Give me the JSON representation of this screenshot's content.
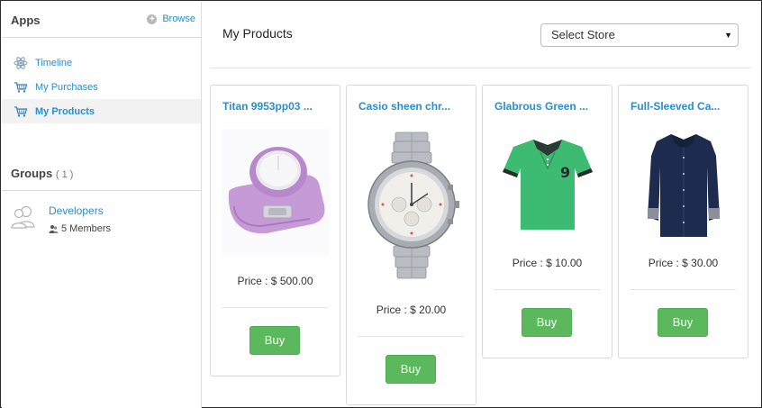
{
  "sidebar": {
    "apps_title": "Apps",
    "browse_label": "Browse",
    "nav": [
      {
        "label": "Timeline",
        "icon": "atom-icon"
      },
      {
        "label": "My Purchases",
        "icon": "cart-icon"
      },
      {
        "label": "My Products",
        "icon": "cart-icon",
        "active": true
      }
    ],
    "groups_title": "Groups",
    "groups_count": "( 1 )",
    "groups": [
      {
        "name": "Developers",
        "members": "5 Members"
      }
    ]
  },
  "main": {
    "title": "My Products",
    "store_select": {
      "value": "Select Store"
    },
    "products": [
      {
        "title": "Titan 9953pp03 ...",
        "price": "Price : $ 500.00",
        "buy": "Buy",
        "image": "watch-purple"
      },
      {
        "title": "Casio sheen chr...",
        "price": "Price : $ 20.00",
        "buy": "Buy",
        "image": "watch-silver"
      },
      {
        "title": "Glabrous Green ...",
        "price": "Price : $ 10.00",
        "buy": "Buy",
        "image": "polo-green"
      },
      {
        "title": "Full-Sleeved Ca...",
        "price": "Price : $ 30.00",
        "buy": "Buy",
        "image": "shirt-navy"
      }
    ]
  },
  "colors": {
    "link": "#2a8fc7",
    "buy_green": "#5cb85c",
    "watch_purple": "#c69ad6",
    "polo_green": "#3dbb73",
    "shirt_navy": "#1d2b4e"
  }
}
